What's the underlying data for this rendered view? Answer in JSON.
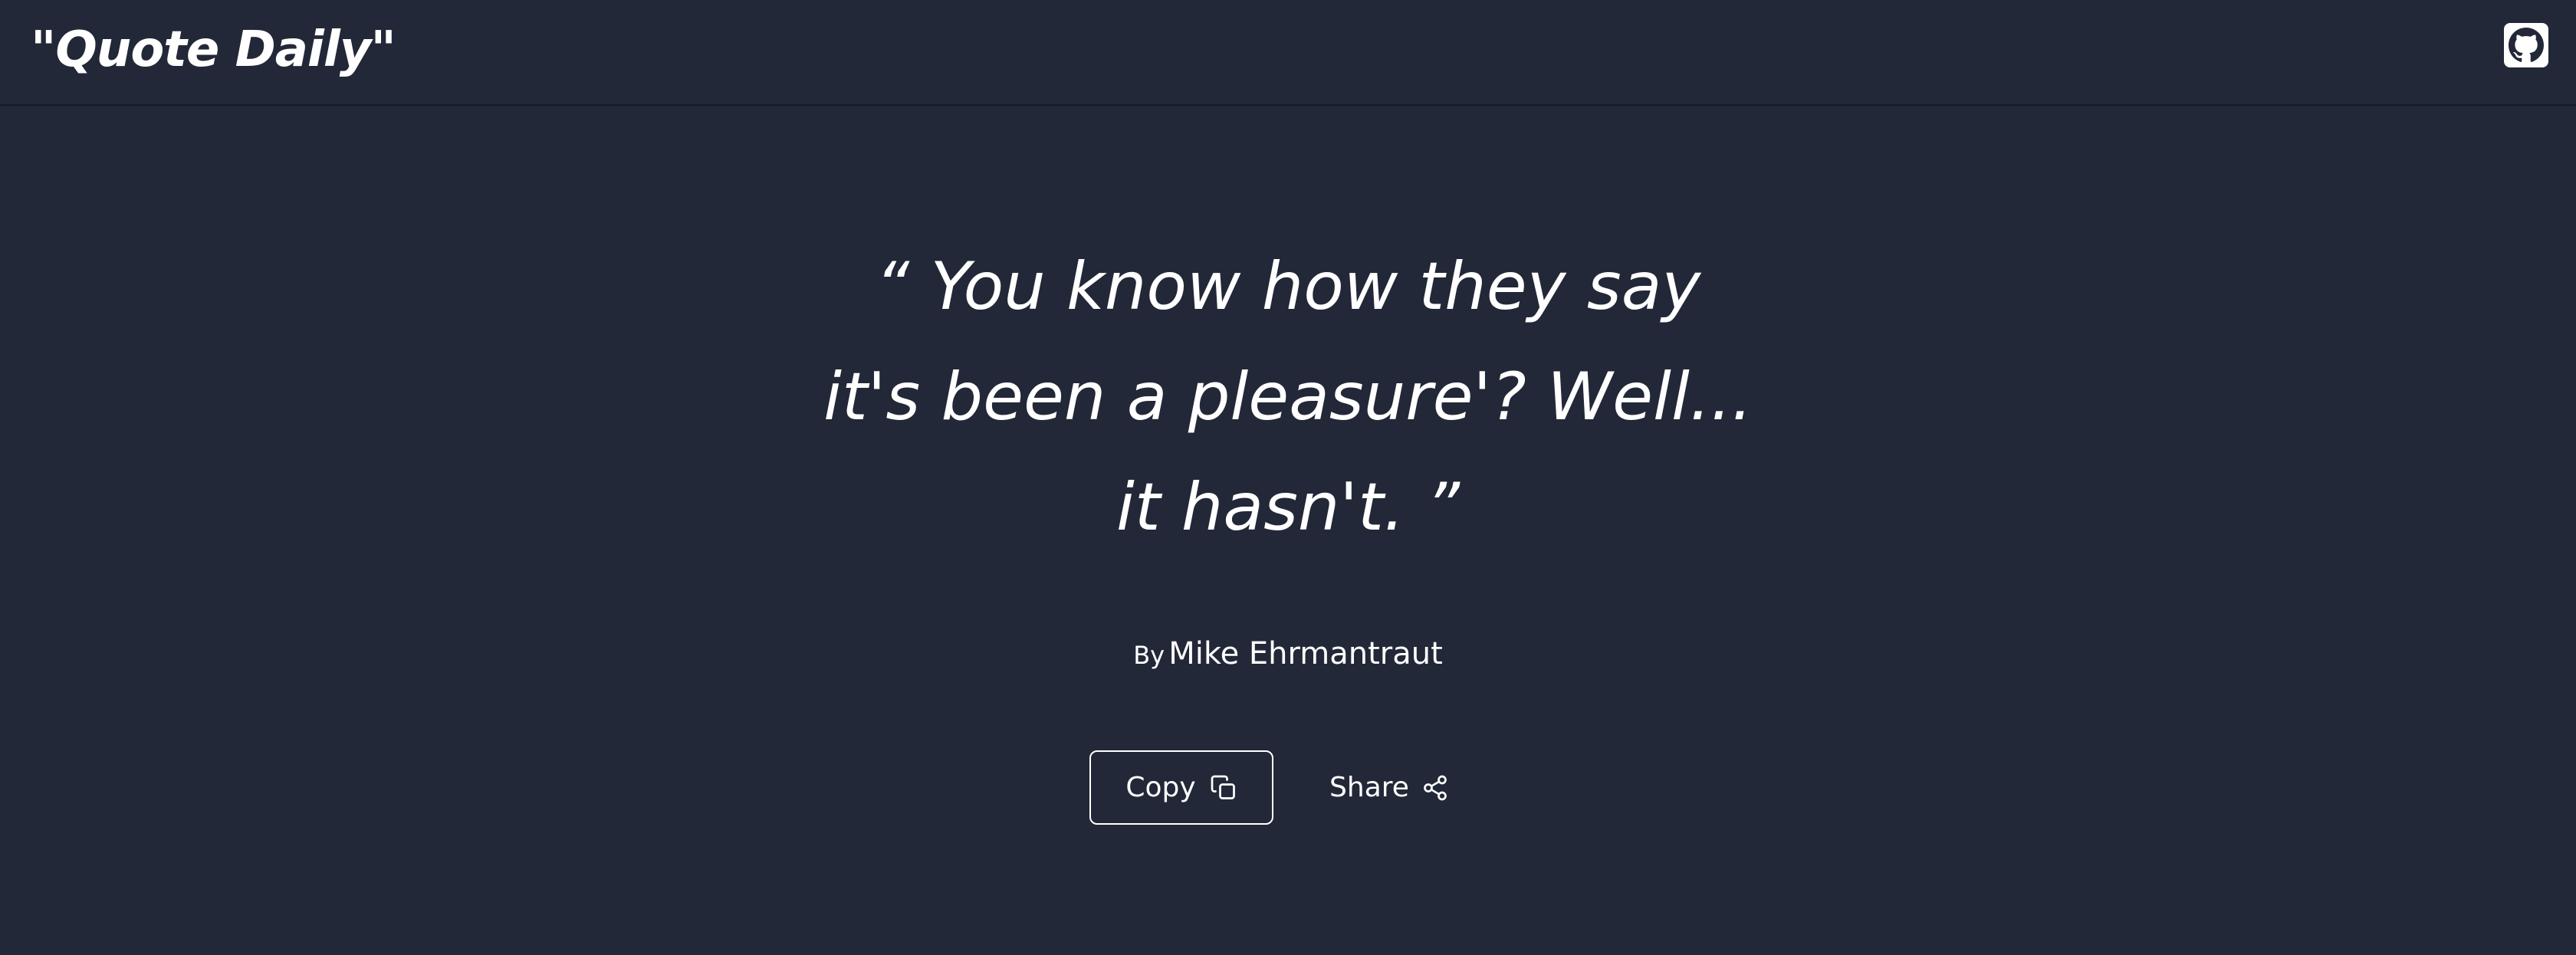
{
  "header": {
    "brand": "\"Quote Daily\"",
    "github_icon": "github-icon"
  },
  "quote": {
    "lines": [
      "“ You know how they say",
      "it's been a pleasure'? Well...",
      "it hasn't. ”"
    ],
    "by_label": "By",
    "author": "Mike Ehrmantraut"
  },
  "actions": {
    "copy_label": "Copy",
    "copy_icon": "copy-icon",
    "share_label": "Share",
    "share_icon": "share-icon"
  },
  "colors": {
    "background": "#222837",
    "text": "#ffffff",
    "divider": "#161b26"
  }
}
